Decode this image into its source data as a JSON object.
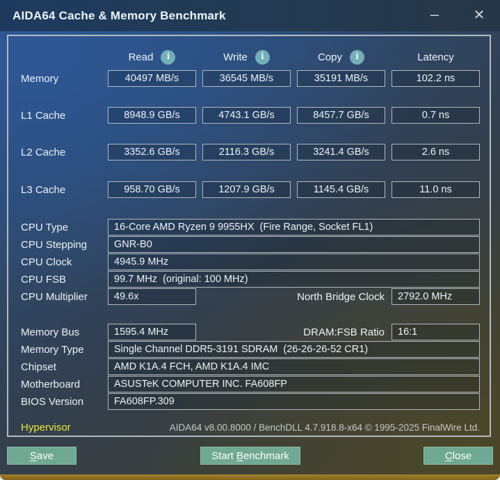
{
  "window": {
    "title": "AIDA64 Cache & Memory Benchmark",
    "minimize_glyph": "–",
    "close_glyph": "✕"
  },
  "icons": {
    "info_glyph": "i"
  },
  "colors": {
    "accent_button": "#6fa893",
    "info_icon": "#74afb8",
    "hypervisor_label": "#e6ea3c",
    "bottom_strip": "#8a6b20",
    "box_border": "#b2bac0"
  },
  "table": {
    "headers": {
      "read": "Read",
      "write": "Write",
      "copy": "Copy",
      "latency": "Latency"
    },
    "rows": [
      {
        "label": "Memory",
        "read": "40497 MB/s",
        "write": "36545 MB/s",
        "copy": "35191 MB/s",
        "latency": "102.2 ns"
      },
      {
        "label": "L1 Cache",
        "read": "8948.9 GB/s",
        "write": "4743.1 GB/s",
        "copy": "8457.7 GB/s",
        "latency": "0.7 ns"
      },
      {
        "label": "L2 Cache",
        "read": "3352.6 GB/s",
        "write": "2116.3 GB/s",
        "copy": "3241.4 GB/s",
        "latency": "2.6 ns"
      },
      {
        "label": "L3 Cache",
        "read": "958.70 GB/s",
        "write": "1207.9 GB/s",
        "copy": "1145.4 GB/s",
        "latency": "11.0 ns"
      }
    ]
  },
  "cpu": {
    "type": {
      "label": "CPU Type",
      "value": "16-Core AMD Ryzen 9 9955HX  (Fire Range, Socket FL1)"
    },
    "stepping": {
      "label": "CPU Stepping",
      "value": "GNR-B0"
    },
    "clock": {
      "label": "CPU Clock",
      "value": "4945.9 MHz"
    },
    "fsb": {
      "label": "CPU FSB",
      "value": "99.7 MHz  (original: 100 MHz)"
    },
    "multiplier": {
      "label": "CPU Multiplier",
      "value": "49.6x"
    },
    "north_bridge": {
      "label": "North Bridge Clock",
      "value": "2792.0 MHz"
    }
  },
  "memory": {
    "bus": {
      "label": "Memory Bus",
      "value": "1595.4 MHz"
    },
    "dram_fsb": {
      "label": "DRAM:FSB Ratio",
      "value": "16:1"
    },
    "type": {
      "label": "Memory Type",
      "value": "Single Channel DDR5-3191 SDRAM  (26-26-26-52 CR1)"
    },
    "chipset": {
      "label": "Chipset",
      "value": "AMD K1A.4 FCH, AMD K1A.4 IMC"
    },
    "motherboard": {
      "label": "Motherboard",
      "value": "ASUSTeK COMPUTER INC. FA608FP"
    },
    "bios": {
      "label": "BIOS Version",
      "value": "FA608FP.309"
    }
  },
  "footer": {
    "hypervisor_label": "Hypervisor",
    "version_text": "AIDA64 v8.00.8000 / BenchDLL 4.7.918.8-x64 © 1995-2025 FinalWire Ltd."
  },
  "buttons": {
    "save": {
      "pre": "",
      "accel": "S",
      "post": "ave"
    },
    "start": {
      "pre": "Start ",
      "accel": "B",
      "post": "enchmark"
    },
    "close": {
      "pre": "",
      "accel": "C",
      "post": "lose"
    }
  }
}
